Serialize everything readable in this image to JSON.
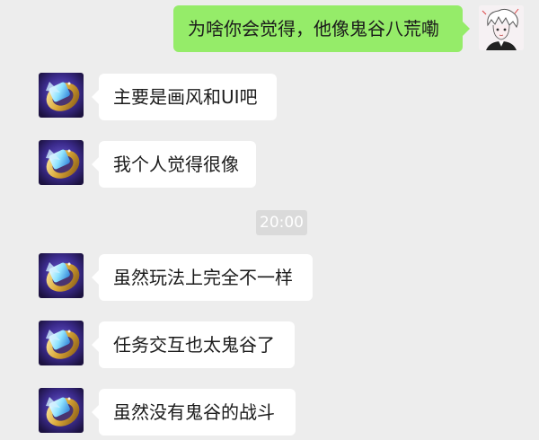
{
  "chat": {
    "messages": [
      {
        "from": "me",
        "text": "为啥你会觉得，他像鬼谷八荒嘞"
      },
      {
        "from": "them",
        "text": "主要是画风和UI吧"
      },
      {
        "from": "them",
        "text": "我个人觉得很像"
      },
      {
        "from": "them",
        "text": "虽然玩法上完全不一样"
      },
      {
        "from": "them",
        "text": "任务交互也太鬼谷了"
      },
      {
        "from": "them",
        "text": "虽然没有鬼谷的战斗"
      }
    ],
    "timestamp": "20:00"
  },
  "colors": {
    "background": "#ededed",
    "incoming_bubble": "#ffffff",
    "outgoing_bubble": "#95ec69",
    "timestamp_bg": "#dadada"
  },
  "icons": {
    "self_avatar": "anime-character-sketch-avatar",
    "contact_avatar": "golden-ring-gem-avatar"
  }
}
